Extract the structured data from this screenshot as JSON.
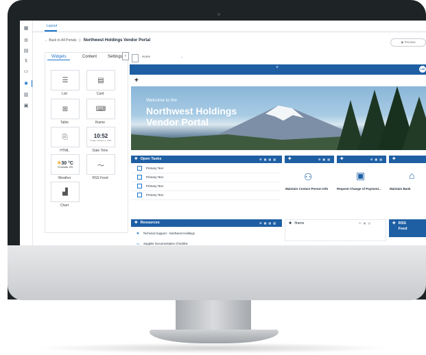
{
  "breadcrumb": {
    "back_label": "← Back to All Portals",
    "separator": "|",
    "portal_title": "Northwest Holdings Vendor Portal"
  },
  "tabs": {
    "layout": "Layout"
  },
  "header": {
    "preview_label": "Preview"
  },
  "panel": {
    "tabs": [
      {
        "label": "Widgets"
      },
      {
        "label": "Content"
      },
      {
        "label": "Settings"
      }
    ],
    "collapse_glyph": "‹",
    "widgets": [
      {
        "label": "List",
        "icon": "list-icon",
        "glyph": "☰"
      },
      {
        "label": "Card",
        "icon": "card-icon",
        "glyph": "▤"
      },
      {
        "label": "Table",
        "icon": "table-icon",
        "glyph": "⊞"
      },
      {
        "label": "Iframe",
        "icon": "iframe-icon",
        "glyph": "⌨"
      },
      {
        "label": "HTML",
        "icon": "html-icon",
        "glyph": "⎘"
      },
      {
        "label": "Date Time",
        "icon": "clock-icon",
        "time": "10:52",
        "date": "Friday, October 1, 2021"
      },
      {
        "label": "Weather",
        "icon": "weather-icon",
        "temp": "30 °C",
        "location": "Canada, ON"
      },
      {
        "label": "RSS Feed",
        "icon": "rss-icon",
        "glyph": "〜"
      },
      {
        "label": "Chart",
        "icon": "chart-icon",
        "glyph": "▟"
      }
    ]
  },
  "canvas": {
    "page_select": "Home",
    "band_plus": "+",
    "avatar_initials": "LM",
    "section_plus": "+",
    "hero": {
      "line1": "Welcome to the",
      "line2": "Northwest Holdings",
      "line3": "Vendor Portal"
    },
    "open_tasks": {
      "title": "Open Tasks",
      "rows": [
        "Primary Text",
        "Primary Text",
        "Primary Text",
        "Primary Text"
      ]
    },
    "quick_links": [
      {
        "label": "Maintain Contact Person Info",
        "icon": "person-icon"
      },
      {
        "label": "Request Change of Payment...",
        "icon": "payment-icon"
      },
      {
        "label": "Maintain Bank",
        "icon": "bank-icon"
      }
    ],
    "resources": {
      "title": "Resources",
      "rows": [
        "Technical Support - Northwest Holdings",
        "Supplier Documentation Checklist"
      ]
    },
    "iframe_widget": {
      "title": "Iframe"
    },
    "rss_widget": {
      "title": "RSS Feed"
    }
  },
  "colors": {
    "brand_blue": "#1e5fa4",
    "accent": "#1a73c8"
  }
}
